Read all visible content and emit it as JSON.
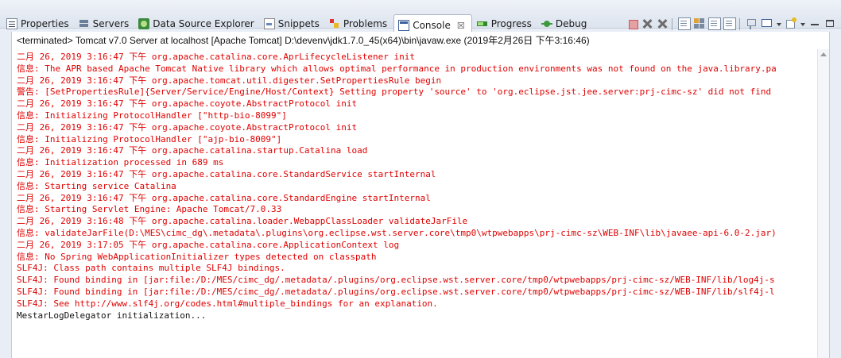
{
  "tabs": [
    {
      "label": "Properties",
      "icon": "properties-icon"
    },
    {
      "label": "Servers",
      "icon": "servers-icon"
    },
    {
      "label": "Data Source Explorer",
      "icon": "data-source-explorer-icon"
    },
    {
      "label": "Snippets",
      "icon": "snippets-icon"
    },
    {
      "label": "Problems",
      "icon": "problems-icon"
    },
    {
      "label": "Console",
      "icon": "console-icon",
      "active": true,
      "close": "☒"
    },
    {
      "label": "Progress",
      "icon": "progress-icon"
    },
    {
      "label": "Debug",
      "icon": "debug-icon"
    }
  ],
  "status_line": "<terminated> Tomcat v7.0 Server at localhost [Apache Tomcat] D:\\devenv\\jdk1.7.0_45(x64)\\bin\\javaw.exe (2019年2月26日 下午3:16:46)",
  "console_lines": [
    {
      "text": "二月 26, 2019 3:16:47 下午 org.apache.catalina.core.AprLifecycleListener init",
      "stream": "stderr"
    },
    {
      "text": "信息: The APR based Apache Tomcat Native library which allows optimal performance in production environments was not found on the java.library.pa",
      "stream": "stderr"
    },
    {
      "text": "二月 26, 2019 3:16:47 下午 org.apache.tomcat.util.digester.SetPropertiesRule begin",
      "stream": "stderr"
    },
    {
      "text": "警告: [SetPropertiesRule]{Server/Service/Engine/Host/Context} Setting property 'source' to 'org.eclipse.jst.jee.server:prj-cimc-sz' did not find",
      "stream": "stderr"
    },
    {
      "text": "二月 26, 2019 3:16:47 下午 org.apache.coyote.AbstractProtocol init",
      "stream": "stderr"
    },
    {
      "text": "信息: Initializing ProtocolHandler [\"http-bio-8099\"]",
      "stream": "stderr"
    },
    {
      "text": "二月 26, 2019 3:16:47 下午 org.apache.coyote.AbstractProtocol init",
      "stream": "stderr"
    },
    {
      "text": "信息: Initializing ProtocolHandler [\"ajp-bio-8009\"]",
      "stream": "stderr"
    },
    {
      "text": "二月 26, 2019 3:16:47 下午 org.apache.catalina.startup.Catalina load",
      "stream": "stderr"
    },
    {
      "text": "信息: Initialization processed in 689 ms",
      "stream": "stderr"
    },
    {
      "text": "二月 26, 2019 3:16:47 下午 org.apache.catalina.core.StandardService startInternal",
      "stream": "stderr"
    },
    {
      "text": "信息: Starting service Catalina",
      "stream": "stderr"
    },
    {
      "text": "二月 26, 2019 3:16:47 下午 org.apache.catalina.core.StandardEngine startInternal",
      "stream": "stderr"
    },
    {
      "text": "信息: Starting Servlet Engine: Apache Tomcat/7.0.33",
      "stream": "stderr"
    },
    {
      "text": "二月 26, 2019 3:16:48 下午 org.apache.catalina.loader.WebappClassLoader validateJarFile",
      "stream": "stderr"
    },
    {
      "text": "信息: validateJarFile(D:\\MES\\cimc_dg\\.metadata\\.plugins\\org.eclipse.wst.server.core\\tmp0\\wtpwebapps\\prj-cimc-sz\\WEB-INF\\lib\\javaee-api-6.0-2.jar)",
      "stream": "stderr"
    },
    {
      "text": "二月 26, 2019 3:17:05 下午 org.apache.catalina.core.ApplicationContext log",
      "stream": "stderr"
    },
    {
      "text": "信息: No Spring WebApplicationInitializer types detected on classpath",
      "stream": "stderr"
    },
    {
      "text": "SLF4J: Class path contains multiple SLF4J bindings.",
      "stream": "stderr"
    },
    {
      "text": "SLF4J: Found binding in [jar:file:/D:/MES/cimc_dg/.metadata/.plugins/org.eclipse.wst.server.core/tmp0/wtpwebapps/prj-cimc-sz/WEB-INF/lib/log4j-s",
      "stream": "stderr"
    },
    {
      "text": "SLF4J: Found binding in [jar:file:/D:/MES/cimc_dg/.metadata/.plugins/org.eclipse.wst.server.core/tmp0/wtpwebapps/prj-cimc-sz/WEB-INF/lib/slf4j-l",
      "stream": "stderr"
    },
    {
      "text": "SLF4J: See http://www.slf4j.org/codes.html#multiple_bindings for an explanation.",
      "stream": "stderr"
    },
    {
      "text": "MestarLogDelegator initialization...",
      "stream": "stdout"
    }
  ],
  "toolbar": {
    "buttons": [
      {
        "icon": "terminate-icon"
      },
      {
        "icon": "remove-launch-icon"
      },
      {
        "icon": "remove-all-terminated-icon"
      },
      {
        "icon": "scroll-lock-icon"
      },
      {
        "icon": "show-on-output-icon"
      },
      {
        "icon": "word-wrap-icon"
      },
      {
        "icon": "pin-console-icon"
      },
      {
        "icon": "display-console-icon"
      },
      {
        "icon": "open-console-icon"
      },
      {
        "icon": "minimize-icon"
      },
      {
        "icon": "maximize-icon"
      }
    ]
  },
  "colors": {
    "stderr": "#e00000",
    "stdout": "#111111",
    "tab_bar": "#dde4ee"
  }
}
